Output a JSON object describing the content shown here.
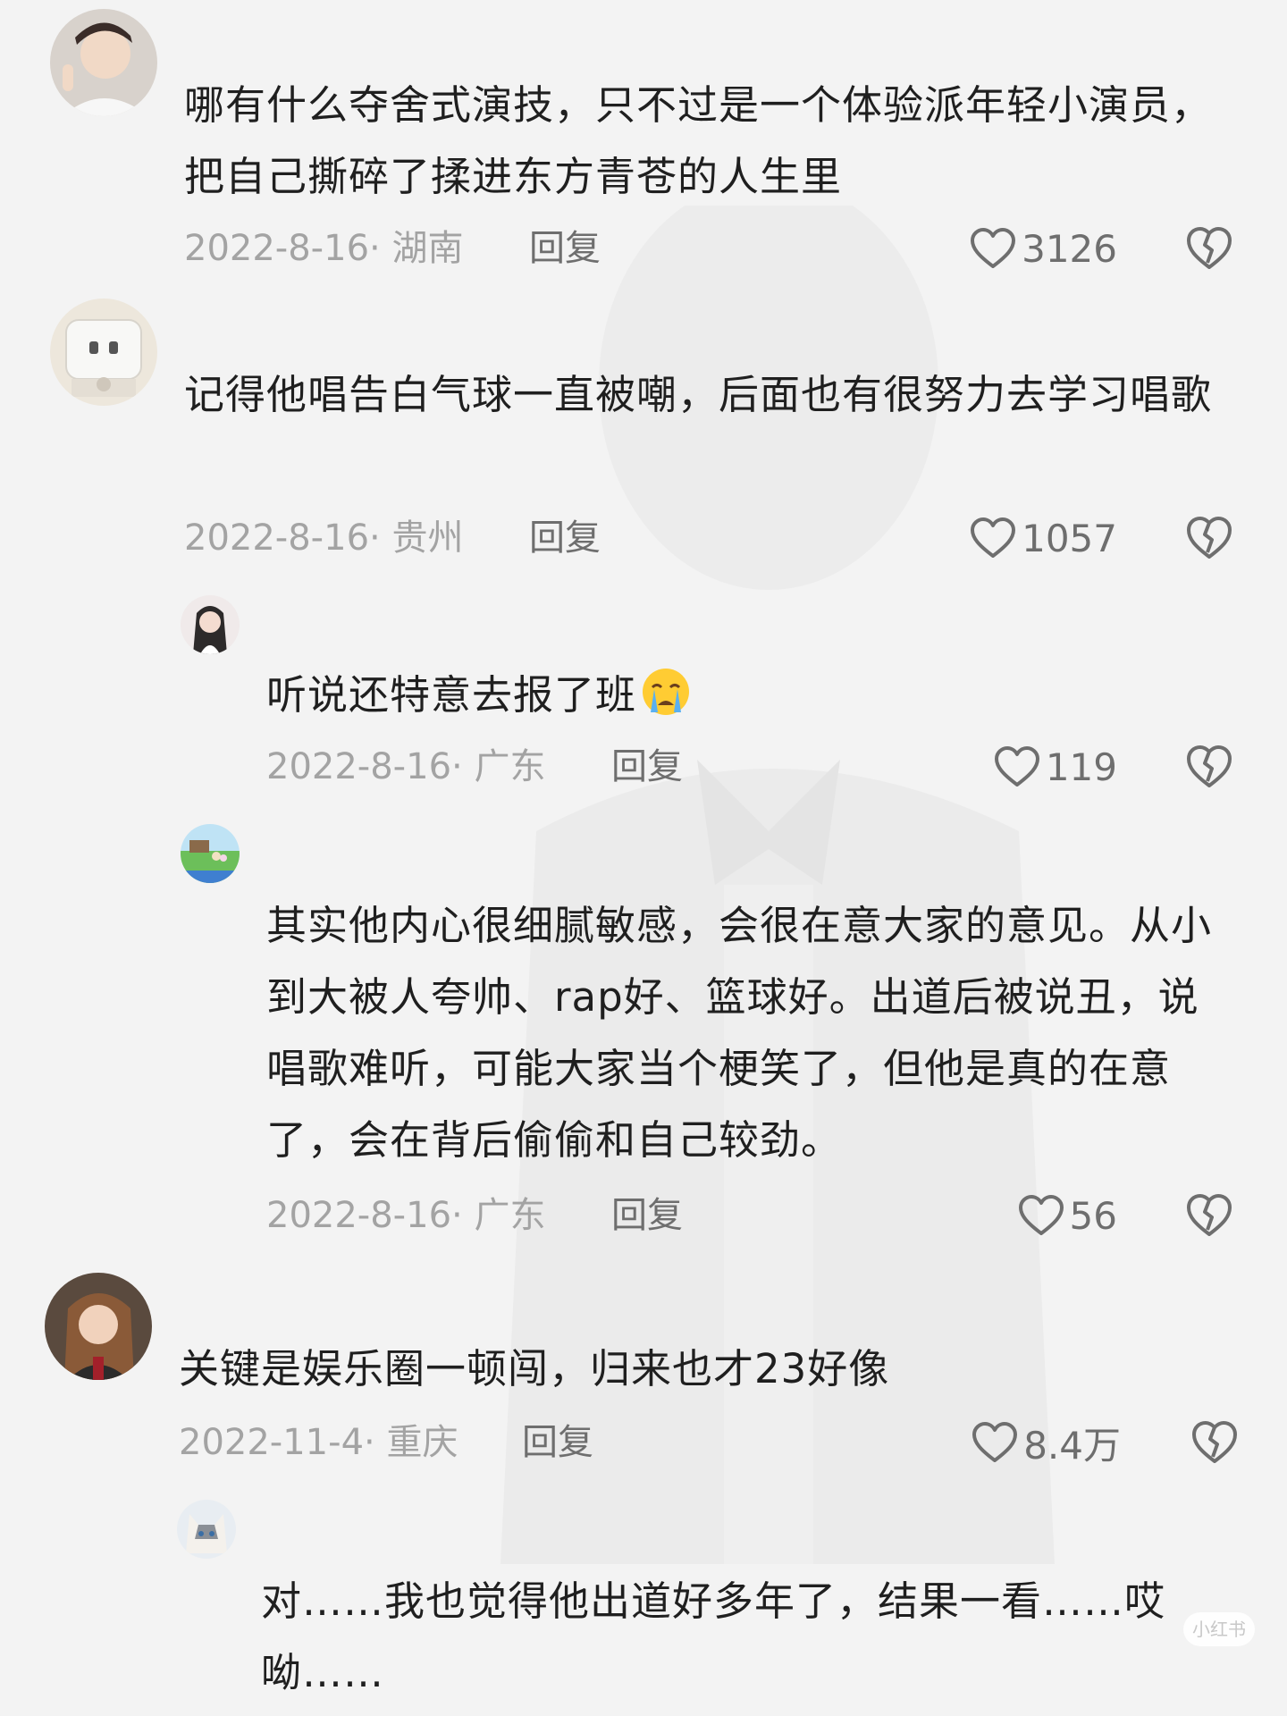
{
  "comments": [
    {
      "text": "哪有什么夺舍式演技，只不过是一个体验派年轻小演员，把自己撕碎了揉进东方青苍的人生里",
      "date": "2022-8-16",
      "location": "湖南",
      "reply_label": "回复",
      "likes": "3126"
    },
    {
      "text": "记得他唱告白气球一直被嘲，后面也有很努力去学习唱歌",
      "date": "2022-8-16",
      "location": "贵州",
      "reply_label": "回复",
      "likes": "1057"
    },
    {
      "text": "听说还特意去报了班",
      "emoji": "crying-face",
      "date": "2022-8-16",
      "location": "广东",
      "reply_label": "回复",
      "likes": "119"
    },
    {
      "text": "其实他内心很细腻敏感，会很在意大家的意见。从小到大被人夸帅、rap好、篮球好。出道后被说丑，说唱歌难听，可能大家当个梗笑了，但他是真的在意了，会在背后偷偷和自己较劲。",
      "date": "2022-8-16",
      "location": "广东",
      "reply_label": "回复",
      "likes": "56"
    },
    {
      "text": "关键是娱乐圈一顿闯，归来也才23好像",
      "date": "2022-11-4",
      "location": "重庆",
      "reply_label": "回复",
      "likes": "8.4万"
    },
    {
      "text": "对……我也觉得他出道好多年了，结果一看……哎呦……"
    }
  ],
  "watermark": "小红书",
  "icons": {
    "like": "heart-outline-icon",
    "dislike": "broken-heart-icon"
  }
}
